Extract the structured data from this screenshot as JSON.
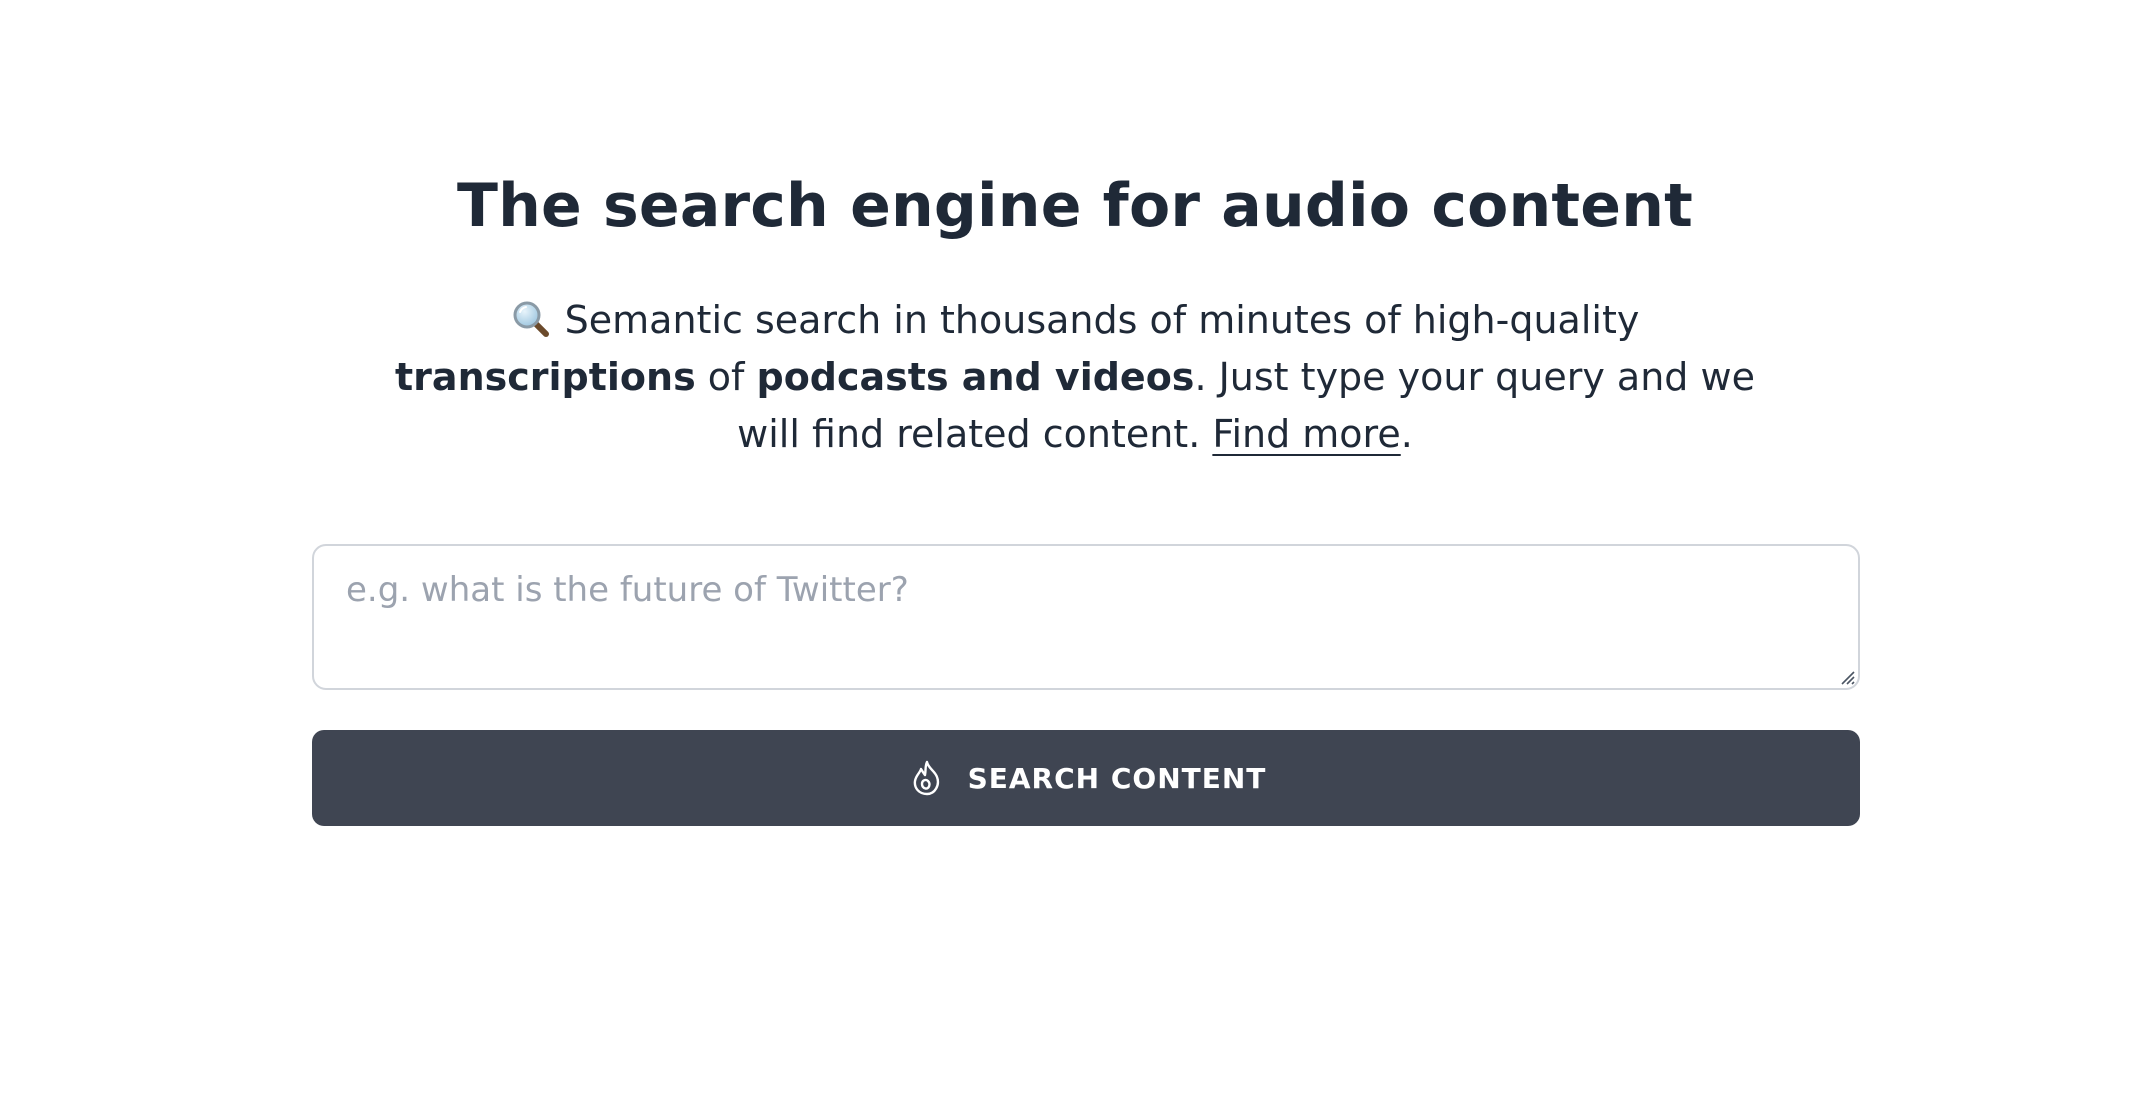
{
  "hero": {
    "title": "The search engine for audio content",
    "description": {
      "part1": "Semantic search in thousands of minutes of high-quality ",
      "bold1": "transcriptions",
      "part2": " of ",
      "bold2": "podcasts and videos",
      "part3": ". Just type your query and we will find related content. ",
      "link_label": "Find more",
      "end": "."
    },
    "icon": "magnifying-glass-emoji"
  },
  "search": {
    "placeholder": "e.g. what is the future of Twitter?",
    "value": "",
    "button_label": "SEARCH CONTENT",
    "button_icon": "flame-icon"
  },
  "colors": {
    "text": "#1f2937",
    "button_bg": "#3f4552",
    "button_text": "#ffffff",
    "placeholder": "#9ca3af",
    "input_border": "#d1d5db"
  }
}
